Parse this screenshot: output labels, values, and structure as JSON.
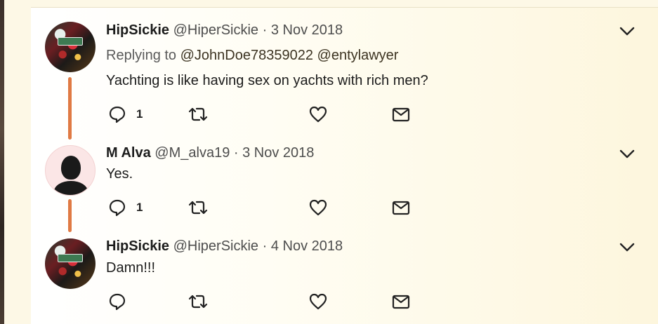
{
  "tweets": [
    {
      "name": "HipSickie",
      "handle": "@HiperSickie",
      "separator": "·",
      "date": "3 Nov 2018",
      "replying_prefix": "Replying to",
      "mentions": [
        "@JohnDoe78359022",
        "@entylawyer"
      ],
      "text": "Yachting is like having sex on yachts with rich men?",
      "reply_count": "1"
    },
    {
      "name": "M Alva",
      "handle": "@M_alva19",
      "separator": "·",
      "date": "3 Nov 2018",
      "text": "Yes.",
      "reply_count": "1"
    },
    {
      "name": "HipSickie",
      "handle": "@HiperSickie",
      "separator": "·",
      "date": "4 Nov 2018",
      "text": "Damn!!!",
      "reply_count": ""
    }
  ],
  "icons": {
    "reply": "reply-icon",
    "retweet": "retweet-icon",
    "like": "heart-icon",
    "dm": "envelope-icon",
    "more": "chevron-down-icon"
  },
  "colors": {
    "thread_line": "#e07a44",
    "background": "#fdf8e6"
  }
}
